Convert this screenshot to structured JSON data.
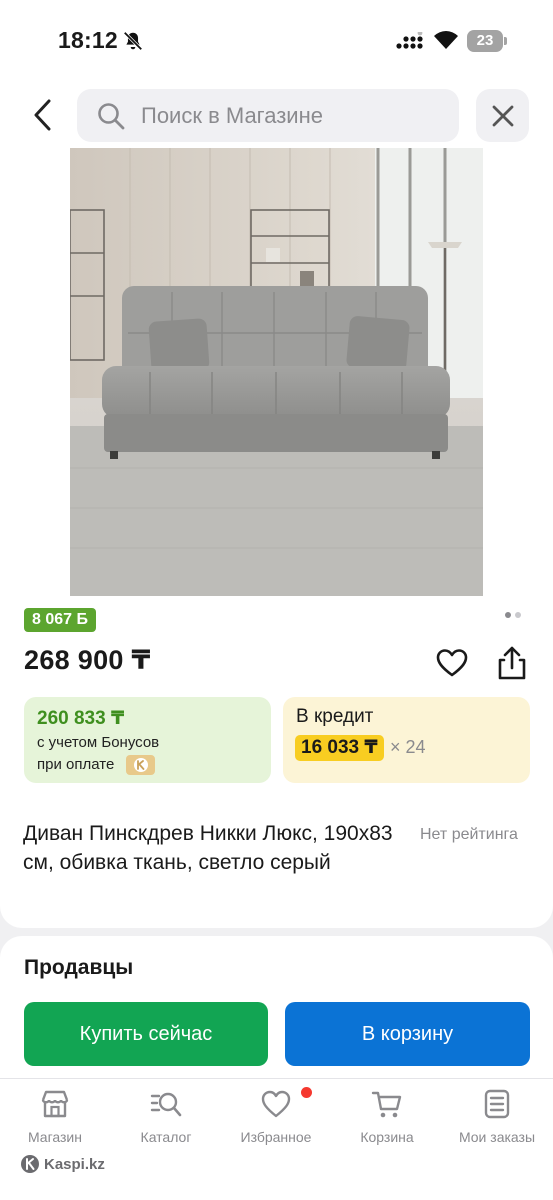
{
  "status_bar": {
    "time": "18:12",
    "battery": "23"
  },
  "search": {
    "placeholder": "Поиск в Магазине"
  },
  "product": {
    "bonus_badge": "8 067 Б",
    "price": "268 900 ₸",
    "title": "Диван Пинскдрев Никки Люкс, 190x83 см, обивка ткань, светло серый",
    "rating": "Нет рейтинга",
    "image_dots": 2,
    "active_dot": 1
  },
  "bonus_offer": {
    "price": "260 833 ₸",
    "line1": "с учетом Бонусов",
    "line2": "при оплате"
  },
  "credit_offer": {
    "title": "В кредит",
    "monthly": "16 033 ₸",
    "months": "× 24"
  },
  "sellers": {
    "title": "Продавцы",
    "buy_now": "Купить сейчас",
    "to_cart": "В корзину"
  },
  "bottom_nav": {
    "items": [
      {
        "label": "Магазин",
        "icon": "store-icon"
      },
      {
        "label": "Каталог",
        "icon": "catalog-search-icon"
      },
      {
        "label": "Избранное",
        "icon": "heart-icon"
      },
      {
        "label": "Корзина",
        "icon": "cart-icon"
      },
      {
        "label": "Мои заказы",
        "icon": "orders-icon"
      }
    ]
  },
  "brand": {
    "name": "Kaspi.kz"
  },
  "colors": {
    "bonus_green": "#5ca52f",
    "buy_now_green": "#12a553",
    "cart_blue": "#0b73d5",
    "credit_yellow": "#f8cd21",
    "favorites_badge_red": "#f5382f"
  }
}
